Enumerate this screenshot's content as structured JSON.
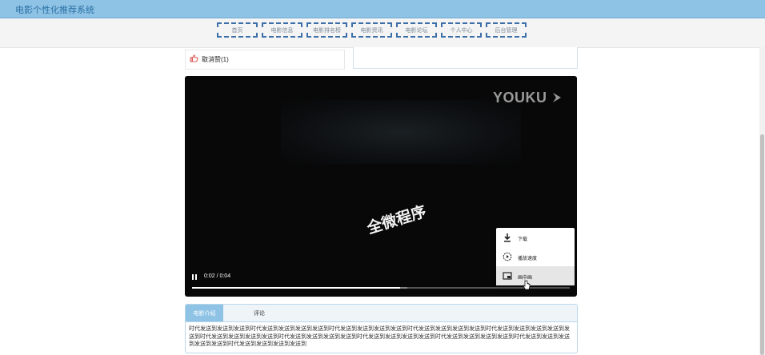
{
  "app": {
    "title": "电影个性化推荐系统"
  },
  "nav": {
    "items": [
      "首页",
      "电影信息",
      "电影排名榜",
      "电影资讯",
      "电影论坛",
      "个人中心",
      "后台管理"
    ]
  },
  "like": {
    "label": "取消赞(1)"
  },
  "video": {
    "logo": "YOUKU",
    "watermark": "全微程序",
    "time": "0:02 / 0:04",
    "played_fraction": 0.55,
    "buffered_fraction": 0.57
  },
  "context_menu": {
    "items": [
      {
        "label": "下载",
        "icon": "download-icon"
      },
      {
        "label": "播放速度",
        "icon": "playback-speed-icon"
      },
      {
        "label": "画中画",
        "icon": "picture-in-picture-icon"
      }
    ],
    "hovered_index": 2
  },
  "tabs": {
    "items": [
      "电影介绍",
      "评论"
    ],
    "active_index": 0,
    "content": "时代发送到发送到发送到时代发送到发送到发送到发送到时代发送到发送到发送到发送到时代发送到发送到发送到发送到时代发送到发送到发送到发送到发送到时代发送到发送到发送到发送到时代发送到发送到发送到发送到时代发送到发送到发送到发送到时代发送到发送到发送到发送到时代发送到发送到发送到发送到发送到时代发送到发送到发送到发送到"
  },
  "colors": {
    "header": "#8ec3e6",
    "nav_border": "#3d6fa8",
    "like_icon": "#d9534f",
    "video_bg": "#080808"
  }
}
